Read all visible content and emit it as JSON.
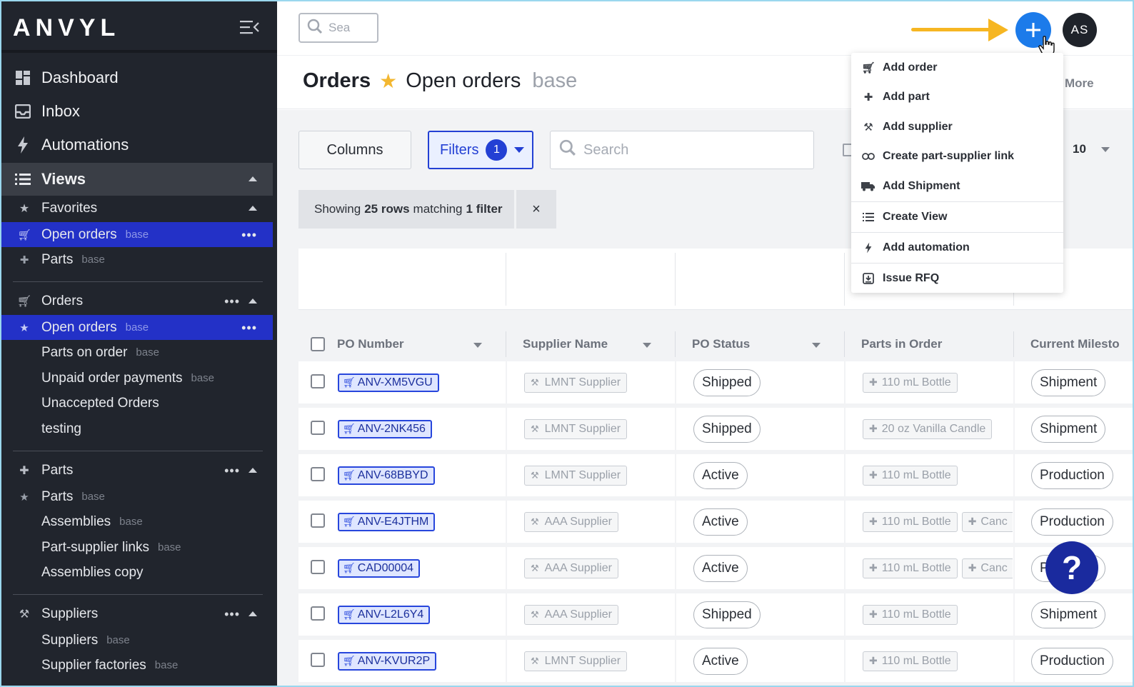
{
  "app": {
    "logo": "ANVYL"
  },
  "topbar": {
    "search_placeholder": "Sea",
    "avatar_initials": "AS"
  },
  "sidebar": {
    "nav": [
      {
        "label": "Dashboard",
        "icon": "dashboard-icon"
      },
      {
        "label": "Inbox",
        "icon": "inbox-icon"
      },
      {
        "label": "Automations",
        "icon": "bolt-icon"
      },
      {
        "label": "Views",
        "icon": "list-icon"
      }
    ],
    "favorites": {
      "label": "Favorites",
      "items": [
        {
          "label": "Open orders",
          "tag": "base",
          "icon": "cart-icon"
        },
        {
          "label": "Parts",
          "tag": "base",
          "icon": "puzzle-icon"
        }
      ]
    },
    "orders": {
      "label": "Orders",
      "items": [
        {
          "label": "Open orders",
          "tag": "base"
        },
        {
          "label": "Parts on order",
          "tag": "base"
        },
        {
          "label": "Unpaid order payments",
          "tag": "base"
        },
        {
          "label": "Unaccepted Orders",
          "tag": ""
        },
        {
          "label": "testing",
          "tag": ""
        }
      ]
    },
    "parts": {
      "label": "Parts",
      "items": [
        {
          "label": "Parts",
          "tag": "base"
        },
        {
          "label": "Assemblies",
          "tag": "base"
        },
        {
          "label": "Part-supplier links",
          "tag": "base"
        },
        {
          "label": "Assemblies copy",
          "tag": ""
        }
      ]
    },
    "suppliers": {
      "label": "Suppliers",
      "items": [
        {
          "label": "Suppliers",
          "tag": "base"
        },
        {
          "label": "Supplier factories",
          "tag": "base"
        }
      ]
    }
  },
  "header": {
    "title": "Orders",
    "view_name": "Open orders",
    "view_tag": "base",
    "more_label": "More"
  },
  "toolbar": {
    "columns_label": "Columns",
    "filters_label": "Filters",
    "filters_count": "1",
    "search_placeholder": "Search",
    "page_size": "10"
  },
  "filter_banner": {
    "prefix": "Showing",
    "rows": "25 rows",
    "middle": "matching",
    "filter": "1 filter",
    "close": "×"
  },
  "table": {
    "columns": [
      "PO Number",
      "Supplier Name",
      "PO Status",
      "Parts in Order",
      "Current Milesto"
    ],
    "rows": [
      {
        "po": "ANV-XM5VGU",
        "supplier": "LMNT Supplier",
        "status": "Shipped",
        "parts": [
          "110 mL Bottle"
        ],
        "milestone": "Shipment"
      },
      {
        "po": "ANV-2NK456",
        "supplier": "LMNT Supplier",
        "status": "Shipped",
        "parts": [
          "20 oz Vanilla Candle"
        ],
        "milestone": "Shipment"
      },
      {
        "po": "ANV-68BBYD",
        "supplier": "LMNT Supplier",
        "status": "Active",
        "parts": [
          "110 mL Bottle"
        ],
        "milestone": "Production"
      },
      {
        "po": "ANV-E4JTHM",
        "supplier": "AAA Supplier",
        "status": "Active",
        "parts": [
          "110 mL Bottle",
          "Canc"
        ],
        "milestone": "Production"
      },
      {
        "po": "CAD00004",
        "supplier": "AAA Supplier",
        "status": "Active",
        "parts": [
          "110 mL Bottle",
          "Canc"
        ],
        "milestone": "Productio"
      },
      {
        "po": "ANV-L2L6Y4",
        "supplier": "AAA Supplier",
        "status": "Shipped",
        "parts": [
          "110 mL Bottle"
        ],
        "milestone": "Shipment"
      },
      {
        "po": "ANV-KVUR2P",
        "supplier": "LMNT Supplier",
        "status": "Active",
        "parts": [
          "110 mL Bottle"
        ],
        "milestone": "Production"
      }
    ]
  },
  "add_menu": {
    "items": [
      {
        "label": "Add order",
        "icon": "cart-icon"
      },
      {
        "label": "Add part",
        "icon": "puzzle-icon"
      },
      {
        "label": "Add supplier",
        "icon": "factory-icon"
      },
      {
        "label": "Create part-supplier link",
        "icon": "link-icon"
      },
      {
        "label": "Add Shipment",
        "icon": "truck-icon"
      },
      {
        "label": "Create View",
        "icon": "list-icon"
      },
      {
        "label": "Add automation",
        "icon": "bolt-icon"
      },
      {
        "label": "Issue RFQ",
        "icon": "download-box-icon"
      }
    ]
  },
  "help": {
    "label": "?"
  },
  "colors": {
    "accent": "#2340d4",
    "sidebar_bg": "#21252d",
    "active_item": "#2331c7",
    "add_button": "#1c7bea",
    "arrow": "#f6b622"
  }
}
